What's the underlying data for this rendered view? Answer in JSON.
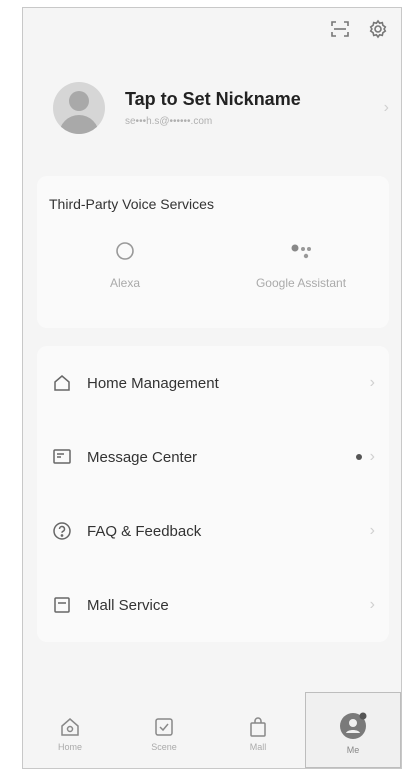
{
  "header": {
    "scan_icon": "scan-icon",
    "settings_icon": "gear-icon"
  },
  "profile": {
    "nickname": "Tap to Set Nickname",
    "email": "se•••h.s@••••••.com"
  },
  "voice_services": {
    "title": "Third-Party Voice Services",
    "items": [
      {
        "label": "Alexa",
        "icon": "alexa-icon"
      },
      {
        "label": "Google Assistant",
        "icon": "google-assistant-icon"
      }
    ]
  },
  "menu": {
    "items": [
      {
        "label": "Home Management",
        "icon": "home-icon"
      },
      {
        "label": "Message Center",
        "icon": "message-icon",
        "badge_dot": true
      },
      {
        "label": "FAQ & Feedback",
        "icon": "help-icon"
      },
      {
        "label": "Mall Service",
        "icon": "mall-icon"
      }
    ]
  },
  "tabbar": {
    "tabs": [
      {
        "label": "Home",
        "icon": "home-icon"
      },
      {
        "label": "Scene",
        "icon": "scene-icon"
      },
      {
        "label": "Mall",
        "icon": "shopping-bag-icon"
      },
      {
        "label": "Me",
        "icon": "user-icon",
        "active": true
      }
    ]
  },
  "colors": {
    "background": "#f5f5f5",
    "card": "#fafafa",
    "text": "#333333",
    "muted": "#aaaaaa"
  }
}
